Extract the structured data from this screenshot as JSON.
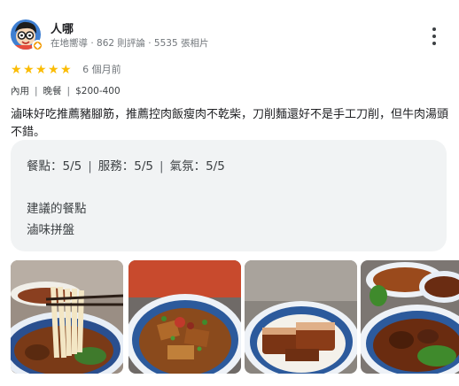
{
  "review": {
    "user": {
      "name": "人哪",
      "meta": "在地嚮導 · 862 則評論 · 5535 張相片",
      "avatar_icon": "avatar-icon",
      "badge_icon": "local-guide-badge-icon"
    },
    "more_icon": "more-vert-icon",
    "rating": {
      "stars": 5,
      "max": 5,
      "date": "6 個月前",
      "color": "#fbbc04"
    },
    "tags": [
      "內用",
      "晚餐",
      "$200-400"
    ],
    "text": "滷味好吃推薦豬腳筋，推薦控肉飯瘦肉不乾柴，刀削麵還好不是手工刀削，但牛肉湯頭不錯。",
    "scores": [
      {
        "label": "餐點：5/5"
      },
      {
        "label": "服務：5/5"
      },
      {
        "label": "氣氛：5/5"
      }
    ],
    "recommended": {
      "title": "建議的餐點",
      "item": "滷味拼盤"
    }
  }
}
